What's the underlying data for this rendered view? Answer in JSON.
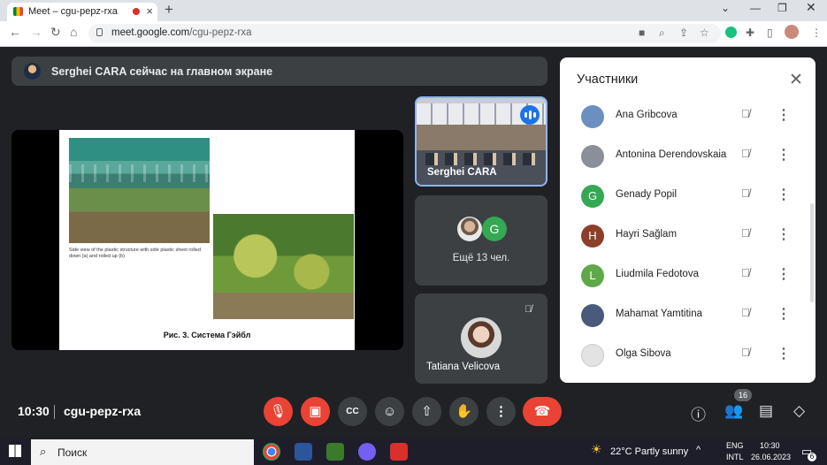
{
  "browser": {
    "tab_title": "Meet – cgu-pepz-rxa",
    "new_tab": "+",
    "url_host": "meet.google.com",
    "url_path": "/cgu-pepz-rxa"
  },
  "banner": {
    "text": "Serghei CARA сейчас на главном экране"
  },
  "slide": {
    "caption": "Side view of the plastic structure with side plastic sheet rolled down (a) and rolled up (b)",
    "title": "Рис. 3. Система Гэйбл"
  },
  "tiles": [
    {
      "name": "Serghei CARA"
    },
    {
      "more_text": "Ещё 13 чел.",
      "avatar_letter": "G"
    },
    {
      "name": "Tatiana Velicova"
    }
  ],
  "bottom": {
    "time": "10:30",
    "meeting_id": "cgu-pepz-rxa",
    "participants_count": "16"
  },
  "panel": {
    "title": "Участники",
    "participants": [
      {
        "name": "Ana Gribcova",
        "avatar": "",
        "color": "#6b8fbf"
      },
      {
        "name": "Antonina Derendovskaia",
        "avatar": "",
        "color": "#8a8f99"
      },
      {
        "name": "Genady Popil",
        "avatar": "G",
        "color": "#34a853"
      },
      {
        "name": "Hayri Sağlam",
        "avatar": "H",
        "color": "#8d3f2a"
      },
      {
        "name": "Liudmila Fedotova",
        "avatar": "L",
        "color": "#5fa84a"
      },
      {
        "name": "Mahamat Yamtitina",
        "avatar": "",
        "color": "#4a5a7a"
      },
      {
        "name": "Olga Sibova",
        "avatar": "",
        "color": "#e3e3e3"
      }
    ]
  },
  "taskbar": {
    "search_placeholder": "Поиск",
    "weather": "22°C  Partly sunny",
    "lang_line1": "ENG",
    "lang_line2": "INTL",
    "clock_time": "10:30",
    "clock_date": "26.06.2023",
    "notif_count": "6"
  }
}
